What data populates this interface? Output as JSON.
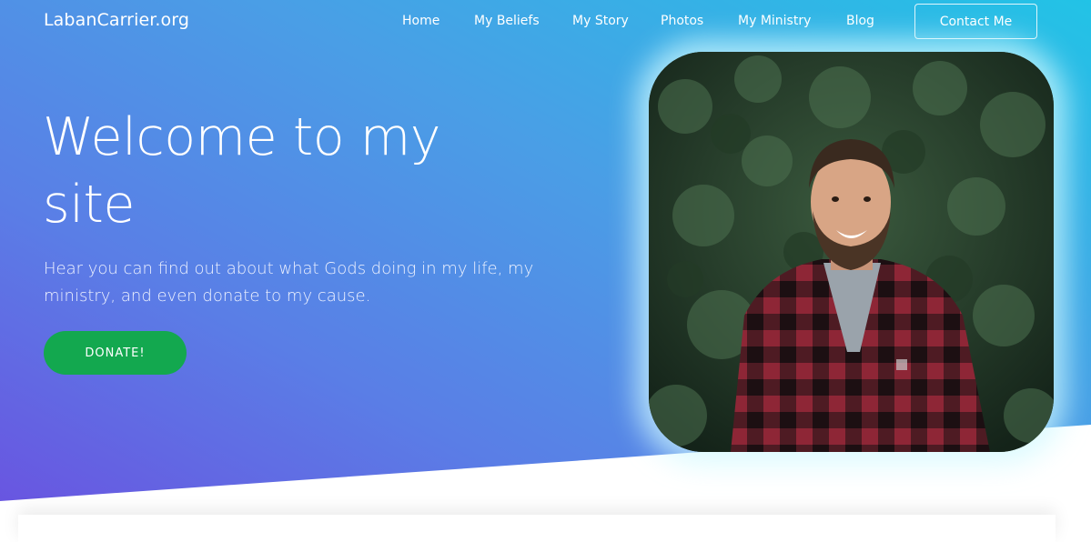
{
  "brand": "LabanCarrier.org",
  "nav": {
    "items": [
      {
        "label": "Home"
      },
      {
        "label": "My Beliefs"
      },
      {
        "label": "My Story"
      },
      {
        "label": "Photos"
      },
      {
        "label": "My Ministry"
      },
      {
        "label": "Blog"
      }
    ],
    "contact_label": "Contact Me"
  },
  "hero": {
    "title": "Welcome to my site",
    "subtitle": "Hear you can find out about what Gods doing in my life, my ministry, and even donate to my cause.",
    "donate_label": "DONATE!"
  },
  "colors": {
    "gradient_start": "#6a52e0",
    "gradient_end": "#22c3e6",
    "donate_green": "#13a84f"
  }
}
